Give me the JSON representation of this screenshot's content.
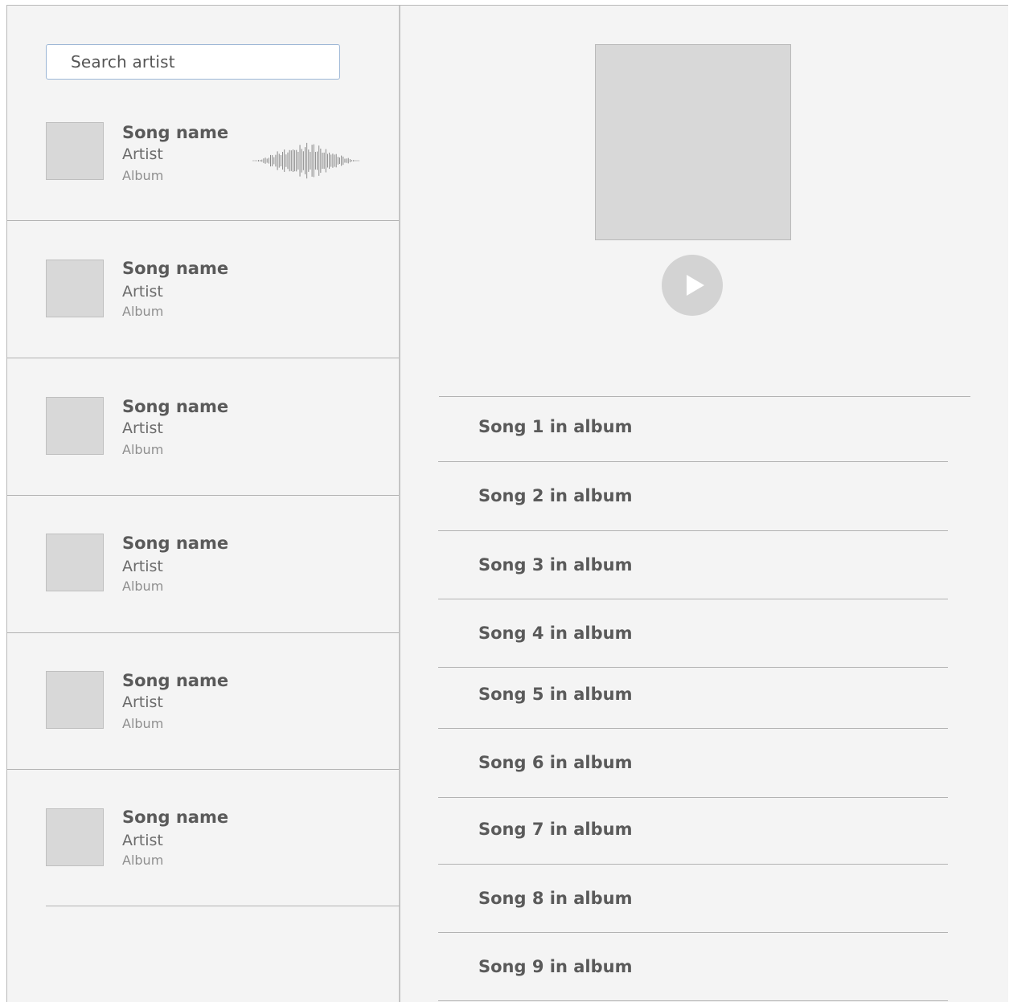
{
  "search": {
    "placeholder": "Search artist"
  },
  "songs": [
    {
      "name": "Song name",
      "artist": "Artist",
      "album": "Album",
      "playing": true
    },
    {
      "name": "Song name",
      "artist": "Artist",
      "album": "Album",
      "playing": false
    },
    {
      "name": "Song name",
      "artist": "Artist",
      "album": "Album",
      "playing": false
    },
    {
      "name": "Song name",
      "artist": "Artist",
      "album": "Album",
      "playing": false
    },
    {
      "name": "Song name",
      "artist": "Artist",
      "album": "Album",
      "playing": false
    },
    {
      "name": "Song name",
      "artist": "Artist",
      "album": "Album",
      "playing": false
    }
  ],
  "album_tracks": [
    {
      "label": "Song 1 in album"
    },
    {
      "label": "Song 2 in album"
    },
    {
      "label": "Song 3 in album"
    },
    {
      "label": "Song 4 in album"
    },
    {
      "label": "Song 5 in album"
    },
    {
      "label": "Song 6 in album"
    },
    {
      "label": "Song 7 in album"
    },
    {
      "label": "Song 8 in album"
    },
    {
      "label": "Song 9 in album"
    }
  ],
  "icons": {
    "play": "play-icon",
    "waveform": "waveform-icon"
  },
  "colors": {
    "background": "#f4f4f4",
    "placeholder": "#d8d8d8",
    "search_border": "#9db7d6",
    "text": "#5a5a5a"
  }
}
